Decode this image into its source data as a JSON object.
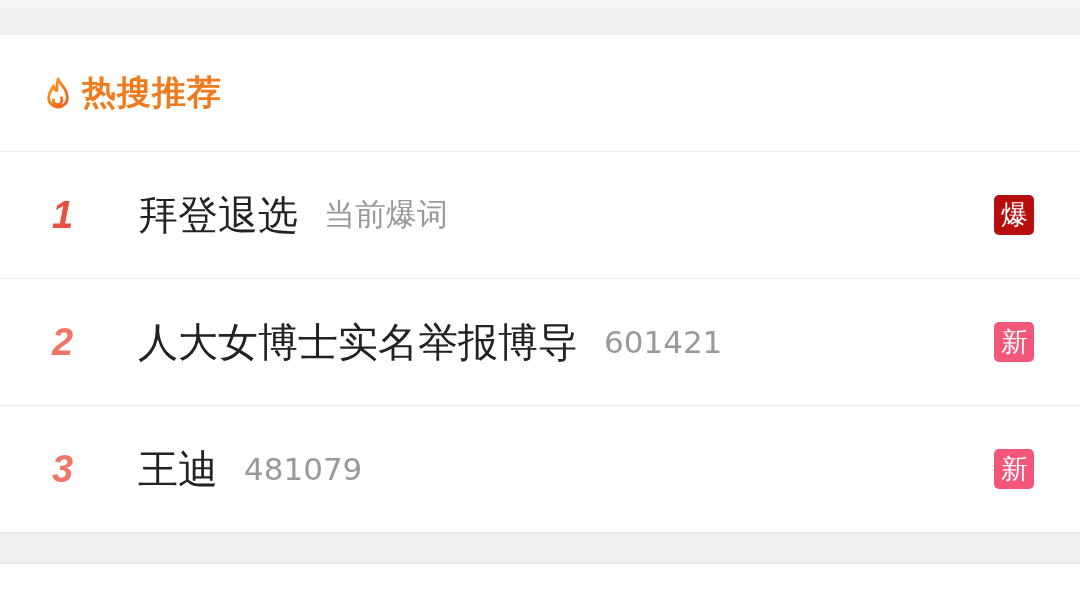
{
  "header": {
    "title": "热搜推荐"
  },
  "items": [
    {
      "rank": "1",
      "title": "拜登退选",
      "meta": "当前爆词",
      "badge": {
        "kind": "hot",
        "label": "爆"
      }
    },
    {
      "rank": "2",
      "title": "人大女博士实名举报博导",
      "meta": "601421",
      "badge": {
        "kind": "new",
        "label": "新"
      }
    },
    {
      "rank": "3",
      "title": "王迪",
      "meta": "481079",
      "badge": {
        "kind": "new",
        "label": "新"
      }
    }
  ]
}
